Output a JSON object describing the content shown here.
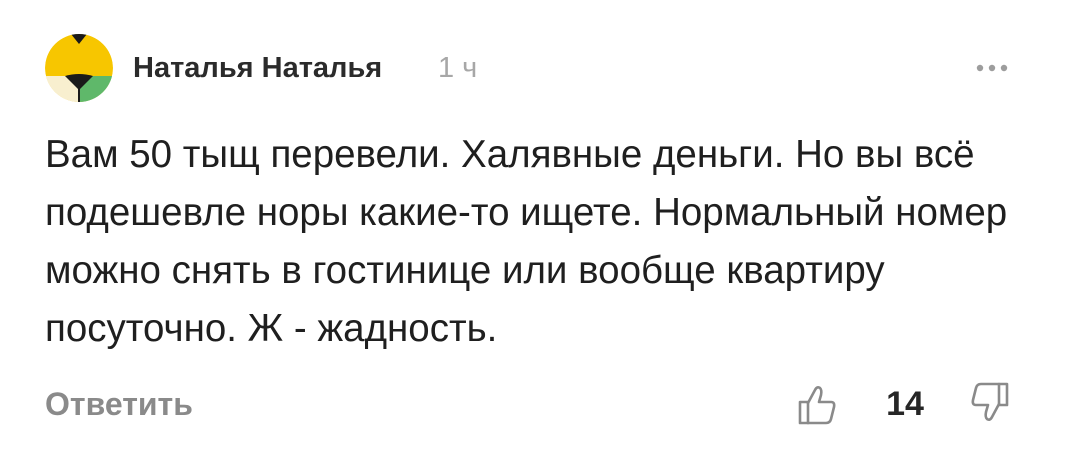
{
  "comment": {
    "author": "Наталья Наталья",
    "timestamp": "1 ч",
    "text": "Вам 50 тыщ перевели. Халявные деньги. Но вы всё подешевле норы какие-то ищете. Нормальный номер можно снять в гостинице или вообще квартиру посуточно. Ж - жадность.",
    "reply_label": "Ответить",
    "like_count": "14"
  },
  "icons": {
    "avatar": "geometric-avatar",
    "more": "more-dots-icon",
    "like": "thumbs-up-icon",
    "dislike": "thumbs-down-icon"
  },
  "colors": {
    "avatar_yellow": "#f7c600",
    "avatar_cream": "#f8efcf",
    "avatar_green": "#5fb86a",
    "avatar_dark": "#1a1a1a",
    "muted_text": "#8a8a8a",
    "timestamp_text": "#a7a7a7"
  }
}
